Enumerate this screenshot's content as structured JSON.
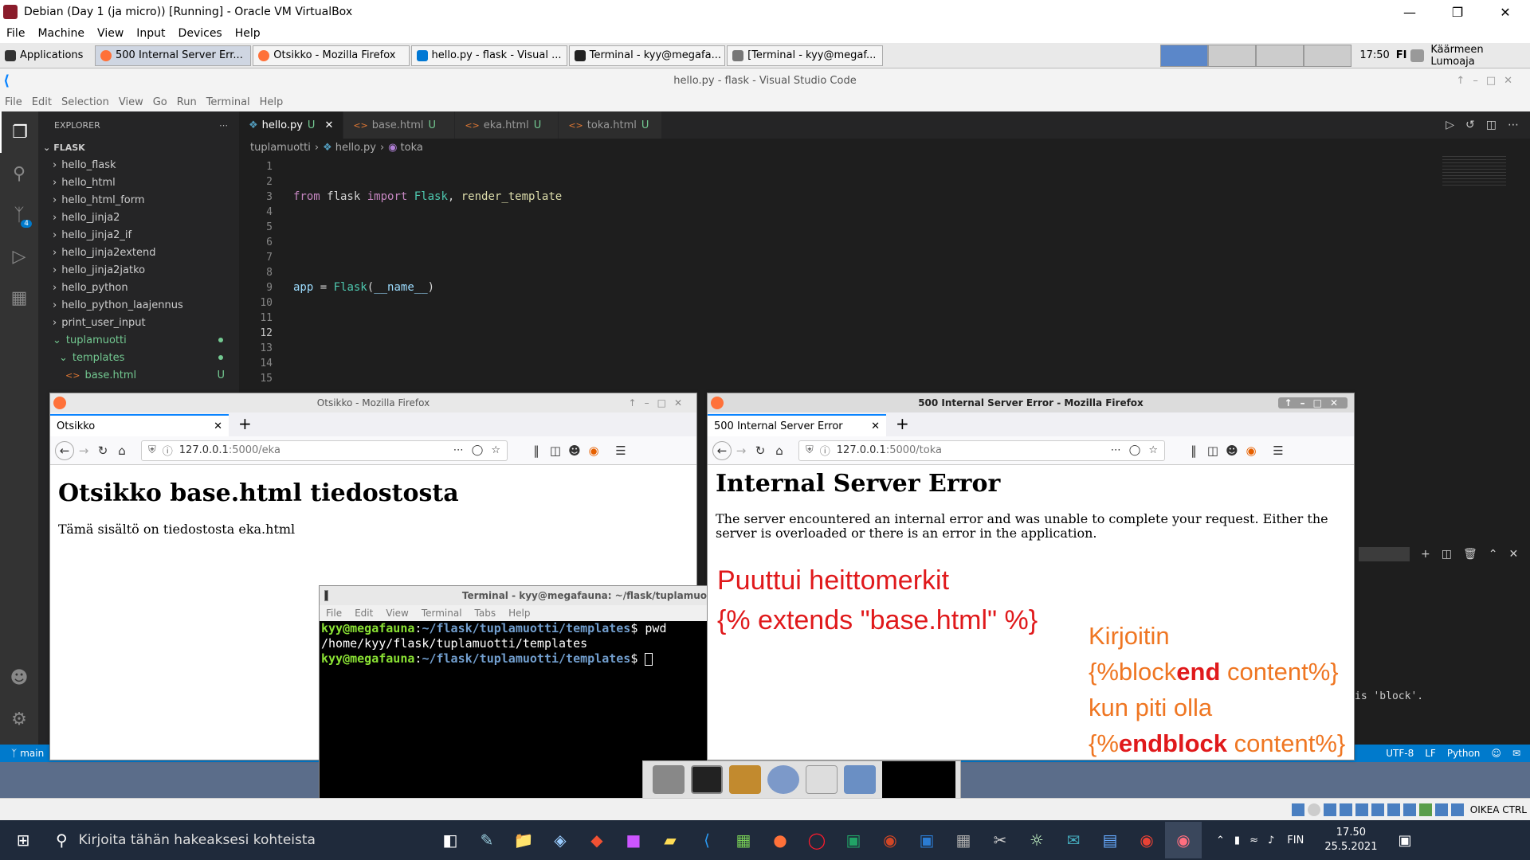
{
  "vbox": {
    "title": "Debian (Day 1 (ja micro)) [Running] - Oracle VM VirtualBox",
    "menu": [
      "File",
      "Machine",
      "View",
      "Input",
      "Devices",
      "Help"
    ],
    "status_right": "OIKEA CTRL"
  },
  "xfce_panel": {
    "applications": "Applications",
    "tasks": [
      "500 Internal Server Err...",
      "Otsikko - Mozilla Firefox",
      "hello.py - flask - Visual ...",
      "Terminal - kyy@megafa...",
      "[Terminal - kyy@megaf..."
    ],
    "clock": "17:50",
    "keyboard": "FI",
    "user": "Käärmeen Lumoaja"
  },
  "vscode": {
    "title": "hello.py - flask - Visual Studio Code",
    "menu": [
      "File",
      "Edit",
      "Selection",
      "View",
      "Go",
      "Run",
      "Terminal",
      "Help"
    ],
    "explorer_label": "EXPLORER",
    "root_folder": "FLASK",
    "tree": [
      "hello_flask",
      "hello_html",
      "hello_html_form",
      "hello_jinja2",
      "hello_jinja2_if",
      "hello_jinja2extend",
      "hello_jinja2jatko",
      "hello_python",
      "hello_python_laajennus",
      "print_user_input",
      "tuplamuotti",
      "templates",
      "base.html"
    ],
    "scm_badge": "4",
    "tabs": [
      {
        "label": "hello.py",
        "badge": "U"
      },
      {
        "label": "base.html",
        "badge": "U"
      },
      {
        "label": "eka.html",
        "badge": "U"
      },
      {
        "label": "toka.html",
        "badge": "U"
      }
    ],
    "breadcrumb": [
      "tuplamuotti",
      "hello.py",
      "toka"
    ],
    "line_numbers": [
      "1",
      "2",
      "3",
      "4",
      "5",
      "6",
      "7",
      "8",
      "9",
      "10",
      "11",
      "12",
      "13",
      "14",
      "15"
    ],
    "status": {
      "branch": "main",
      "encoding": "UTF-8",
      "eol": "LF",
      "language": "Python"
    },
    "panel_snippet": "is 'block'."
  },
  "firefox_left": {
    "title": "Otsikko - Mozilla Firefox",
    "tab": "Otsikko",
    "url_host": "127.0.0.1",
    "url_rest": ":5000/eka",
    "heading": "Otsikko base.html tiedostosta",
    "body": "Tämä sisältö on tiedostosta eka.html"
  },
  "firefox_right": {
    "title": "500 Internal Server Error - Mozilla Firefox",
    "tab": "500 Internal Server Error",
    "url_host": "127.0.0.1",
    "url_rest": ":5000/toka",
    "heading": "Internal Server Error",
    "body": "The server encountered an internal error and was unable to complete your request. Either the server is overloaded or there is an error in the application.",
    "note_red_1": "Puuttui heittomerkit",
    "note_red_2": "{% extends \"base.html\" %}",
    "note_orange_1": "Kirjoitin",
    "note_orange_2a": "{%block",
    "note_orange_2b": "end",
    "note_orange_2c": " content%}",
    "note_orange_3": "kun piti olla",
    "note_orange_4a": "{%",
    "note_orange_4b": "endblock",
    "note_orange_4c": " content%}"
  },
  "terminal": {
    "title": "Terminal - kyy@megafauna: ~/flask/tuplamuo",
    "menu": [
      "File",
      "Edit",
      "View",
      "Terminal",
      "Tabs",
      "Help"
    ],
    "user": "kyy@megafauna",
    "path": "~/flask/tuplamuotti/templates",
    "cmd": "$ pwd",
    "output": "/home/kyy/flask/tuplamuotti/templates",
    "prompt_end": "$ "
  },
  "windows_taskbar": {
    "search_placeholder": "Kirjoita tähän hakeaksesi kohteista",
    "lang": "FIN",
    "time": "17.50",
    "date": "25.5.2021"
  },
  "colors": {
    "red_note": "#e0191b",
    "orange_note": "#ef7622",
    "vscode_blue": "#007acc"
  }
}
